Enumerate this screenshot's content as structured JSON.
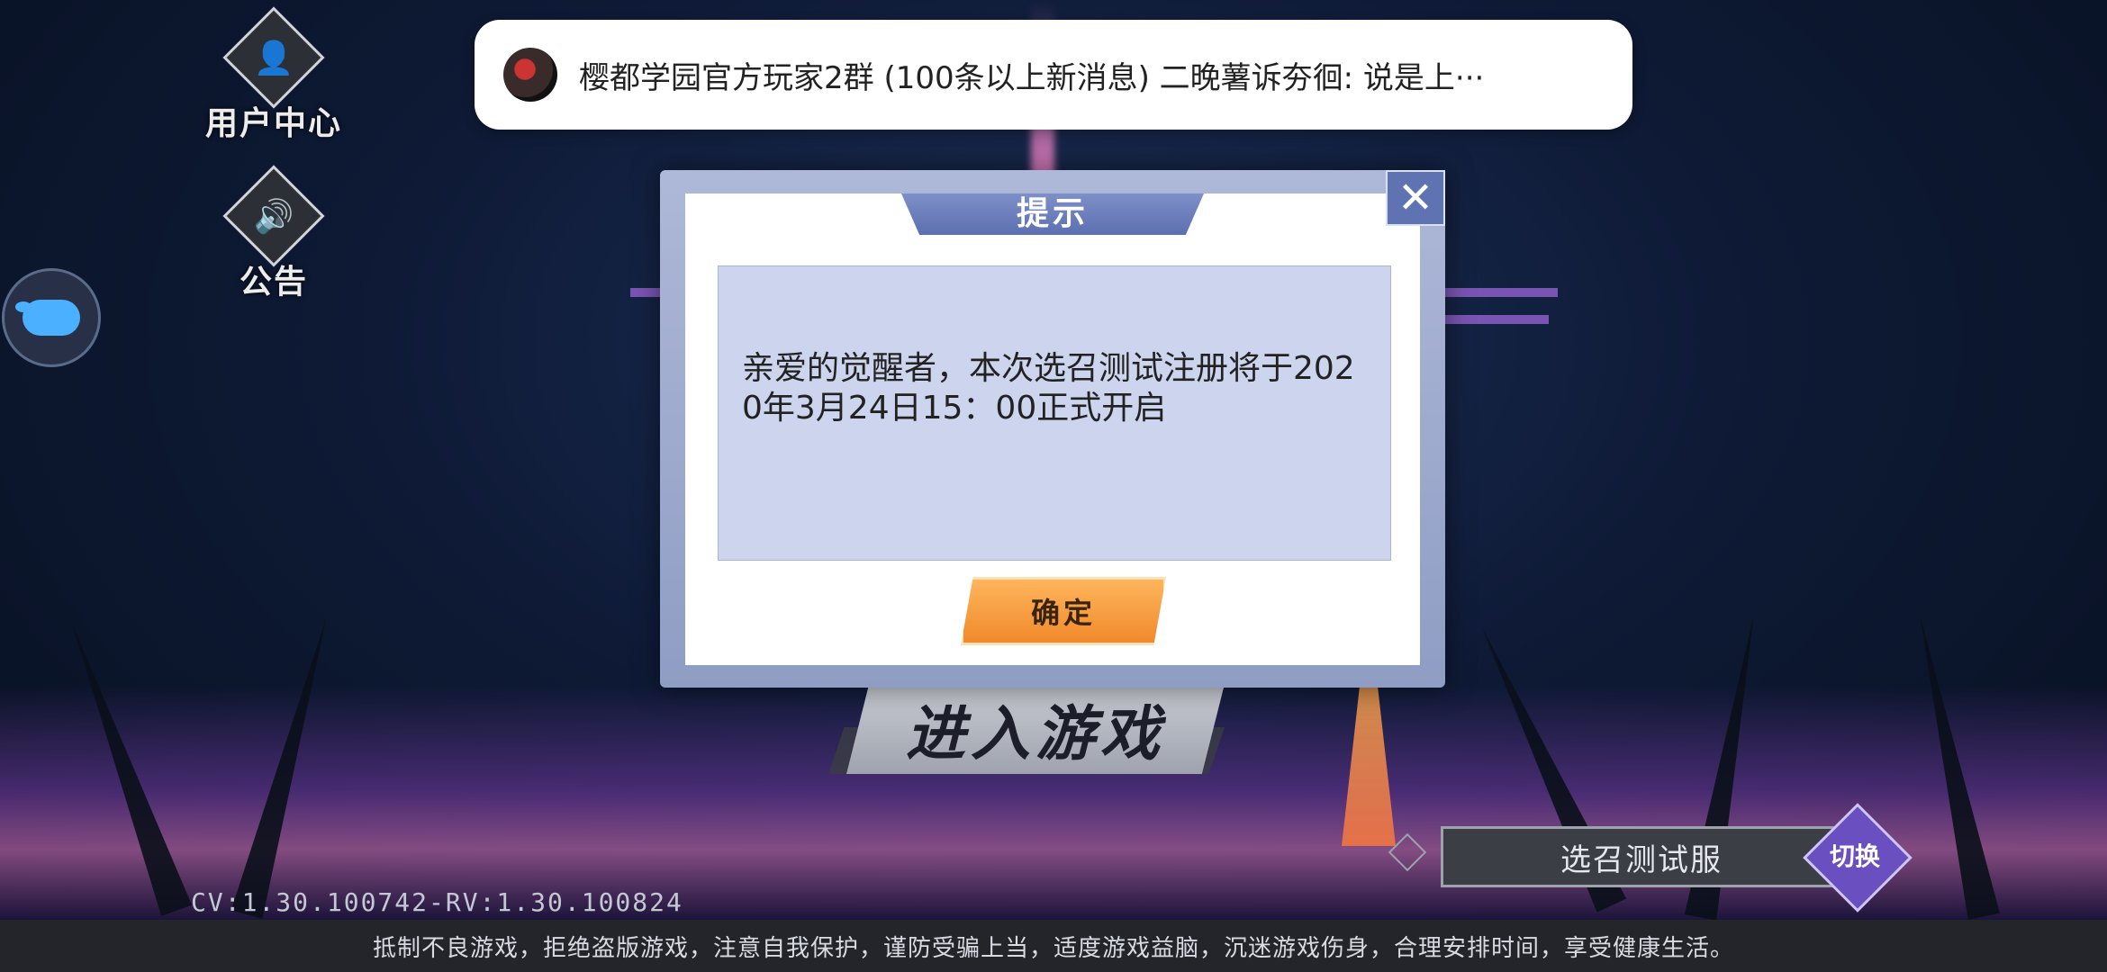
{
  "notification": {
    "text": "樱都学园官方玩家2群 (100条以上新消息) 二晚薯诉夯徊: 说是上···"
  },
  "side_menu": {
    "user_center": {
      "label": "用户中心",
      "icon": "user-icon"
    },
    "announcement": {
      "label": "公告",
      "icon": "speaker-icon"
    },
    "floating": {
      "icon": "pig-icon"
    }
  },
  "dialog": {
    "title": "提示",
    "message": "亲爱的觉醒者，本次选召测试注册将于2020年3月24日15：00正式开启",
    "confirm_label": "确定",
    "close_symbol": "✕"
  },
  "main": {
    "enter_game_label": "进入游戏"
  },
  "server": {
    "name": "选召测试服",
    "switch_label": "切换"
  },
  "version_text": "CV:1.30.100742-RV:1.30.100824",
  "footer_text": "抵制不良游戏，拒绝盗版游戏，注意自我保护，谨防受骗上当，适度游戏益脑，沉迷游戏伤身，合理安排时间，享受健康生活。",
  "colors": {
    "dialog_accent": "#5c6fb0",
    "confirm_button": "#f08a2c",
    "switch_button": "#6a4fc0"
  }
}
